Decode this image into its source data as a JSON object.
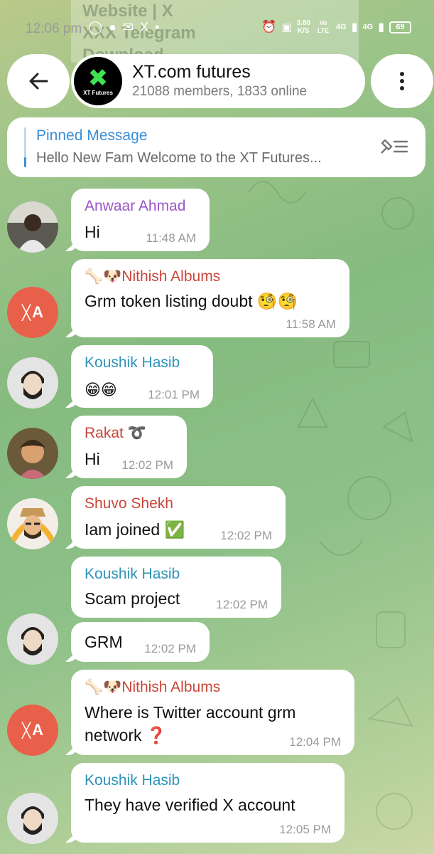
{
  "ghost_overlay": {
    "line1": "Website | X",
    "line2": "XXX Telegram",
    "line3": "Download"
  },
  "status_bar": {
    "time": "12:06 pm",
    "notification_icons": "◯ ● ✉ X •",
    "net_speed": "3.80",
    "net_speed_unit": "K/S",
    "volte": "Vo LTE",
    "network1": "4G",
    "network2": "4G",
    "battery": "69"
  },
  "header": {
    "title": "XT.com futures",
    "subtitle": "21088 members, 1833 online",
    "logo_text": "XT Futures"
  },
  "pinned": {
    "label": "Pinned Message",
    "text": "Hello New Fam Welcome to the XT Futures..."
  },
  "messages": [
    {
      "sender": "Anwaar Ahmad",
      "text": "Hi",
      "time": "11:48 AM"
    },
    {
      "sender": "🦴🐶Nithish Albums",
      "text": "Grm token listing doubt 🧐🧐",
      "time": "11:58 AM"
    },
    {
      "sender": "Koushik Hasib",
      "text": "😁😁",
      "time": "12:01 PM"
    },
    {
      "sender": "Rakat ➰",
      "text": "Hi",
      "time": "12:02 PM"
    },
    {
      "sender": "Shuvo Shekh",
      "text": "Iam joined ✅",
      "time": "12:02 PM"
    },
    {
      "sender": "Koushik Hasib",
      "text": "Scam project",
      "time": "12:02 PM"
    },
    {
      "sender": "",
      "text": "GRM",
      "time": "12:02 PM"
    },
    {
      "sender": "🦴🐶Nithish Albums",
      "line1": "Where is Twitter account grm",
      "line2": "network ❓",
      "time": "12:04 PM"
    },
    {
      "sender": "Koushik Hasib",
      "text": "They have verified X account",
      "time": "12:05 PM"
    }
  ],
  "avatar_letter": "A",
  "colors": {
    "accent": "#3a8fd6",
    "sender_purple": "#9a55c9",
    "sender_red": "#c9463a",
    "sender_teal": "#2e93b8",
    "avatar_red": "#e8604a"
  }
}
